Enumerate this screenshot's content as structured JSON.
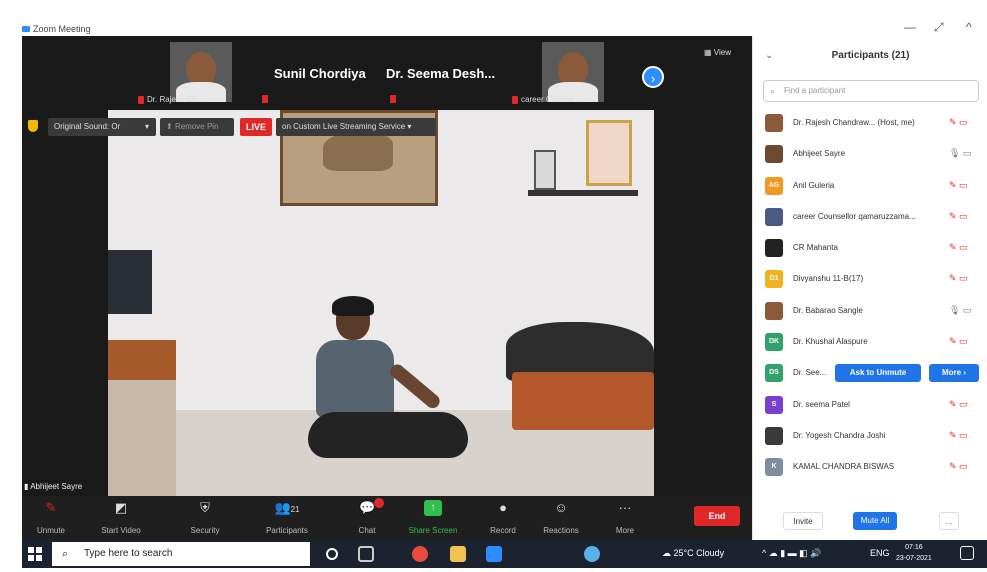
{
  "window": {
    "title": "Zoom Meeting",
    "controls": [
      "—",
      "⤢",
      "^"
    ]
  },
  "thumbnails": [
    {
      "label": "Dr. Rajesh Ch..."
    },
    {
      "label": "career Counse..."
    }
  ],
  "name_tiles": [
    "Sunil Chordiya",
    "Dr. Seema Desh..."
  ],
  "view_label": "View",
  "info_bar": {
    "original_sound": "Original Sound: Or",
    "remove_pin": "Remove Pin",
    "live": "LIVE",
    "streaming": "on Custom Live Streaming Service"
  },
  "self_view_label": "Abhijeet Sayre",
  "toolbar": [
    {
      "label": "Unmute",
      "icon": "mic-muted-icon"
    },
    {
      "label": "Start Video",
      "icon": "video-off-icon"
    },
    {
      "label": "Security",
      "icon": "shield-icon"
    },
    {
      "label": "Participants",
      "icon": "participants-icon",
      "count": "21"
    },
    {
      "label": "Chat",
      "icon": "chat-icon"
    },
    {
      "label": "Share Screen",
      "icon": "share-screen-icon"
    },
    {
      "label": "Record",
      "icon": "record-icon"
    },
    {
      "label": "Reactions",
      "icon": "reactions-icon"
    },
    {
      "label": "More",
      "icon": "more-icon"
    }
  ],
  "end_label": "End",
  "participants_panel": {
    "title": "Participants (21)",
    "search_placeholder": "Find a participant",
    "items": [
      {
        "name": "Dr. Rajesh Chandraw...  (Host, me)",
        "avatar": "",
        "color": "#8a5a3a",
        "muted": true
      },
      {
        "name": "Abhijeet Sayre",
        "avatar": "",
        "color": "#6b4a2f",
        "muted": false
      },
      {
        "name": "Anil Guleria",
        "avatar": "AG",
        "color": "#f29a1f",
        "muted": true
      },
      {
        "name": "career Counsellor qamaruzzama...",
        "avatar": "",
        "color": "#4a5a80",
        "muted": true
      },
      {
        "name": "CR Mahanta",
        "avatar": "",
        "color": "#222222",
        "muted": true
      },
      {
        "name": "Divyanshu 11-B(17)",
        "avatar": "D1",
        "color": "#f2b21f",
        "muted": true
      },
      {
        "name": "Dr. Babarao Sangle",
        "avatar": "",
        "color": "#8a5a3a",
        "muted": false
      },
      {
        "name": "Dr. Khushal Alaspure",
        "avatar": "DK",
        "color": "#2fa36b",
        "muted": true
      },
      {
        "name": "Dr. See...",
        "avatar": "DS",
        "color": "#2fa36b",
        "muted": true,
        "actions": [
          "Ask to Unmute",
          "More ›"
        ]
      },
      {
        "name": "Dr. seema Patel",
        "avatar": "S",
        "color": "#7a3fd1",
        "muted": true
      },
      {
        "name": "Dr. Yogesh Chandra Joshi",
        "avatar": "",
        "color": "#3a3a3a",
        "muted": true
      },
      {
        "name": "KAMAL CHANDRA BISWAS",
        "avatar": "K",
        "color": "#7e8ea0",
        "muted": true
      }
    ],
    "invite": "Invite",
    "mute_all": "Mute All",
    "more": "..."
  },
  "taskbar": {
    "search_placeholder": "Type here to search",
    "weather": "25°C  Cloudy",
    "language": "ENG",
    "time": "07:16",
    "date": "23-07-2021"
  }
}
